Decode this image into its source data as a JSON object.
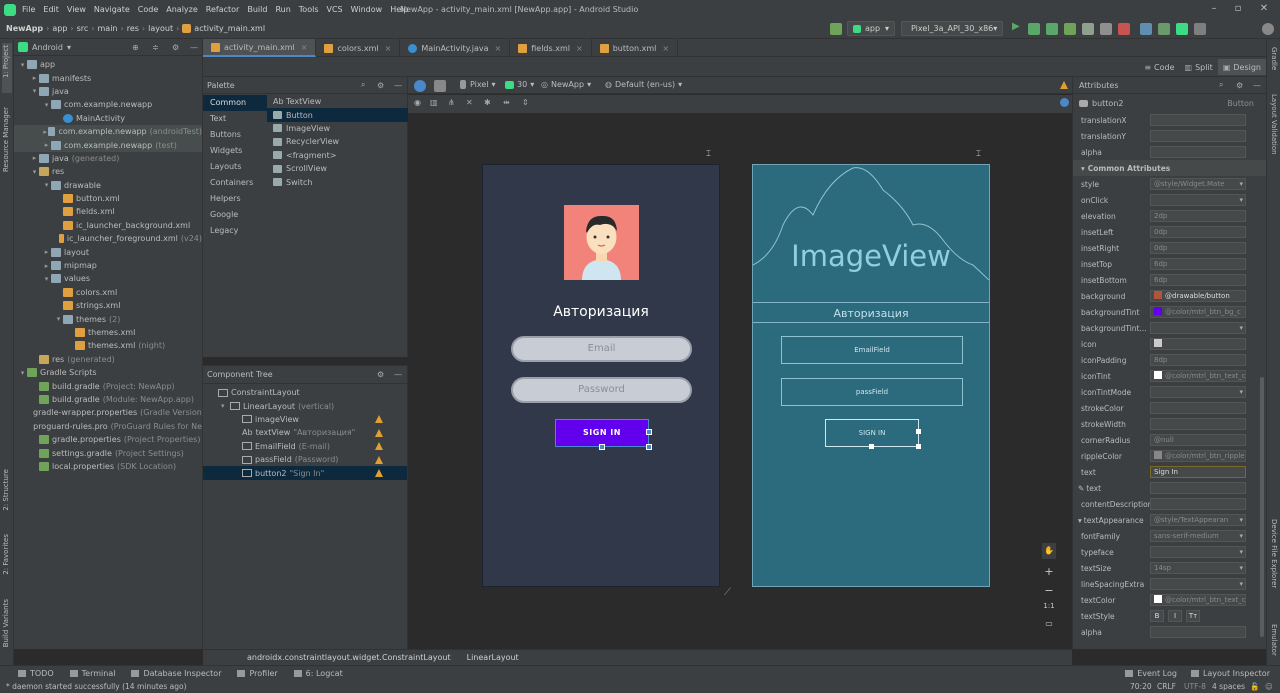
{
  "menubar": {
    "items": [
      "File",
      "Edit",
      "View",
      "Navigate",
      "Code",
      "Analyze",
      "Refactor",
      "Build",
      "Run",
      "Tools",
      "VCS",
      "Window",
      "Help"
    ],
    "title": "NewApp - activity_main.xml [NewApp.app] - Android Studio"
  },
  "navbar": {
    "breadcrumb": [
      "NewApp",
      "app",
      "src",
      "main",
      "res",
      "layout",
      "activity_main.xml"
    ],
    "run_config": "app",
    "device": "Pixel_3a_API_30_x86"
  },
  "left_strip": {
    "project": "1: Project",
    "resource_manager": "Resource Manager",
    "structure": "2: Structure",
    "favorites": "2: Favorites",
    "build_variants": "Build Variants"
  },
  "right_strip": {
    "gradle": "Gradle",
    "layout_validation": "Layout Validation",
    "device_file_explorer": "Device File Explorer",
    "emulator": "Emulator"
  },
  "project": {
    "view": "Android",
    "tree": [
      {
        "d": 0,
        "t": "app",
        "ic": "folder",
        "ex": true
      },
      {
        "d": 1,
        "t": "manifests",
        "ic": "folder",
        "ex": false
      },
      {
        "d": 1,
        "t": "java",
        "ic": "folder",
        "ex": true
      },
      {
        "d": 2,
        "t": "com.example.newapp",
        "ic": "folder",
        "ex": true
      },
      {
        "d": 3,
        "t": "MainActivity",
        "ic": "java"
      },
      {
        "d": 2,
        "t": "com.example.newapp",
        "ic": "folder",
        "ex": false,
        "dim": "(androidTest)",
        "hl": true
      },
      {
        "d": 2,
        "t": "com.example.newapp",
        "ic": "folder",
        "ex": false,
        "dim": "(test)",
        "hl": true
      },
      {
        "d": 1,
        "t": "java",
        "ic": "folder",
        "ex": false,
        "dim": "(generated)"
      },
      {
        "d": 1,
        "t": "res",
        "ic": "resf",
        "ex": true
      },
      {
        "d": 2,
        "t": "drawable",
        "ic": "folder",
        "ex": true
      },
      {
        "d": 3,
        "t": "button.xml",
        "ic": "xml"
      },
      {
        "d": 3,
        "t": "fields.xml",
        "ic": "xml"
      },
      {
        "d": 3,
        "t": "ic_launcher_background.xml",
        "ic": "xml"
      },
      {
        "d": 3,
        "t": "ic_launcher_foreground.xml",
        "ic": "xml",
        "dim": "(v24)"
      },
      {
        "d": 2,
        "t": "layout",
        "ic": "folder",
        "ex": false
      },
      {
        "d": 2,
        "t": "mipmap",
        "ic": "folder",
        "ex": false
      },
      {
        "d": 2,
        "t": "values",
        "ic": "folder",
        "ex": true
      },
      {
        "d": 3,
        "t": "colors.xml",
        "ic": "xml"
      },
      {
        "d": 3,
        "t": "strings.xml",
        "ic": "xml"
      },
      {
        "d": 3,
        "t": "themes",
        "ic": "folder",
        "ex": true,
        "dim": "(2)"
      },
      {
        "d": 4,
        "t": "themes.xml",
        "ic": "xml"
      },
      {
        "d": 4,
        "t": "themes.xml",
        "ic": "xml",
        "dim": "(night)"
      },
      {
        "d": 1,
        "t": "res",
        "ic": "resf",
        "dim": "(generated)"
      },
      {
        "d": 0,
        "t": "Gradle Scripts",
        "ic": "gradle",
        "ex": true
      },
      {
        "d": 1,
        "t": "build.gradle",
        "ic": "gradle",
        "dim": "(Project: NewApp)"
      },
      {
        "d": 1,
        "t": "build.gradle",
        "ic": "gradle",
        "dim": "(Module: NewApp.app)"
      },
      {
        "d": 1,
        "t": "gradle-wrapper.properties",
        "ic": "gradle",
        "dim": "(Gradle Version)"
      },
      {
        "d": 1,
        "t": "proguard-rules.pro",
        "ic": "gradle",
        "dim": "(ProGuard Rules for Ne"
      },
      {
        "d": 1,
        "t": "gradle.properties",
        "ic": "gradle",
        "dim": "(Project Properties)"
      },
      {
        "d": 1,
        "t": "settings.gradle",
        "ic": "gradle",
        "dim": "(Project Settings)"
      },
      {
        "d": 1,
        "t": "local.properties",
        "ic": "gradle",
        "dim": "(SDK Location)"
      }
    ]
  },
  "tabs": [
    {
      "label": "activity_main.xml",
      "color": "#e0a040",
      "active": true
    },
    {
      "label": "colors.xml",
      "color": "#e0a040"
    },
    {
      "label": "MainActivity.java",
      "color": "#3a8fd0"
    },
    {
      "label": "fields.xml",
      "color": "#e0a040"
    },
    {
      "label": "button.xml",
      "color": "#e0a040"
    }
  ],
  "view_modes": {
    "code": "Code",
    "split": "Split",
    "design": "Design"
  },
  "palette": {
    "title": "Palette",
    "categories": [
      "Common",
      "Text",
      "Buttons",
      "Widgets",
      "Layouts",
      "Containers",
      "Helpers",
      "Google",
      "Legacy"
    ],
    "items": [
      "Ab TextView",
      "Button",
      "ImageView",
      "RecyclerView",
      "<fragment>",
      "ScrollView",
      "Switch"
    ]
  },
  "canvas_toolbar": {
    "device": "Pixel",
    "api": "30",
    "theme": "NewApp",
    "locale": "Default (en-us)"
  },
  "ctree": {
    "title": "Component Tree",
    "items": [
      {
        "d": 0,
        "t": "ConstraintLayout",
        "dim": ""
      },
      {
        "d": 1,
        "t": "LinearLayout",
        "dim": "(vertical)",
        "ex": true
      },
      {
        "d": 2,
        "t": "imageView",
        "dim": "",
        "warn": true
      },
      {
        "d": 2,
        "t": "textView",
        "dim": "\"Авторизация\"",
        "warn": true,
        "pre": "Ab"
      },
      {
        "d": 2,
        "t": "EmailField",
        "dim": "(E-mail)",
        "warn": true
      },
      {
        "d": 2,
        "t": "passField",
        "dim": "(Password)",
        "warn": true
      },
      {
        "d": 2,
        "t": "button2",
        "dim": "\"Sign In\"",
        "warn": true,
        "sel": true
      }
    ]
  },
  "design": {
    "title": "Авторизация",
    "email": "Email",
    "password": "Password",
    "button": "SIGN IN"
  },
  "blueprint": {
    "image": "ImageView",
    "title": "Авторизация",
    "email": "EmailField",
    "password": "passField",
    "button": "SIGN IN"
  },
  "attrs": {
    "title": "Attributes",
    "component": "button2",
    "component_type": "Button",
    "section": "Common Attributes",
    "rows": [
      {
        "n": "translationX",
        "v": "",
        "dd": false
      },
      {
        "n": "translationY",
        "v": "",
        "dd": false
      },
      {
        "n": "alpha",
        "v": "",
        "dd": false
      },
      {
        "sec": true
      },
      {
        "n": "style",
        "v": "@style/Widget.Mate",
        "dd": true
      },
      {
        "n": "onClick",
        "v": "",
        "dd": true
      },
      {
        "n": "elevation",
        "v": "2dp",
        "dd": false
      },
      {
        "n": "insetLeft",
        "v": "0dp",
        "dd": false
      },
      {
        "n": "insetRight",
        "v": "0dp",
        "dd": false
      },
      {
        "n": "insetTop",
        "v": "6dp",
        "dd": false
      },
      {
        "n": "insetBottom",
        "v": "6dp",
        "dd": false
      },
      {
        "n": "background",
        "v": "@drawable/button",
        "dd": false,
        "sw": "#b0553a",
        "bright": true
      },
      {
        "n": "backgroundTint",
        "v": "@color/mtrl_btn_bg_c",
        "dd": false,
        "sw": "#6200ee"
      },
      {
        "n": "backgroundTint...",
        "v": "",
        "dd": true
      },
      {
        "n": "icon",
        "v": "",
        "dd": false,
        "sw": "#cccccc"
      },
      {
        "n": "iconPadding",
        "v": "8dp",
        "dd": false
      },
      {
        "n": "iconTint",
        "v": "@color/mtrl_btn_text_c",
        "dd": false,
        "sw": "#ffffff"
      },
      {
        "n": "iconTintMode",
        "v": "",
        "dd": true
      },
      {
        "n": "strokeColor",
        "v": "",
        "dd": false
      },
      {
        "n": "strokeWidth",
        "v": "",
        "dd": false
      },
      {
        "n": "cornerRadius",
        "v": "@null",
        "dd": false
      },
      {
        "n": "rippleColor",
        "v": "@color/mtrl_btn_ripple",
        "dd": false,
        "sw": "#888888"
      },
      {
        "n": "text",
        "v": "Sign In",
        "dd": false,
        "on": true
      },
      {
        "n": "text",
        "v": "",
        "dd": false,
        "pre": "✎"
      },
      {
        "n": "contentDescription",
        "v": "",
        "dd": false
      },
      {
        "n": "textAppearance",
        "v": "@style/TextAppearan",
        "dd": true,
        "pre": "▾"
      },
      {
        "n": "fontFamily",
        "v": "sans-serif-medium",
        "dd": true
      },
      {
        "n": "typeface",
        "v": "",
        "dd": true
      },
      {
        "n": "textSize",
        "v": "14sp",
        "dd": true
      },
      {
        "n": "lineSpacingExtra",
        "v": "",
        "dd": true
      },
      {
        "n": "textColor",
        "v": "@color/mtrl_btn_text_c",
        "dd": false,
        "sw": "#ffffff"
      },
      {
        "n": "textStyle",
        "v": "",
        "dd": false,
        "styles": [
          "B",
          "I",
          "Tт"
        ]
      },
      {
        "n": "alpha",
        "v": "",
        "dd": false
      }
    ]
  },
  "crumb": [
    "androidx.constraintlayout.widget.ConstraintLayout",
    "LinearLayout"
  ],
  "status_tabs": [
    "TODO",
    "Terminal",
    "Database Inspector",
    "Profiler",
    "6: Logcat"
  ],
  "status_right_tabs": [
    "Event Log",
    "Layout Inspector"
  ],
  "status": {
    "message": "* daemon started successfully (14 minutes ago)",
    "position": "70:20",
    "line_sep": "CRLF",
    "encoding": "UTF-8",
    "indent": "4 spaces"
  }
}
